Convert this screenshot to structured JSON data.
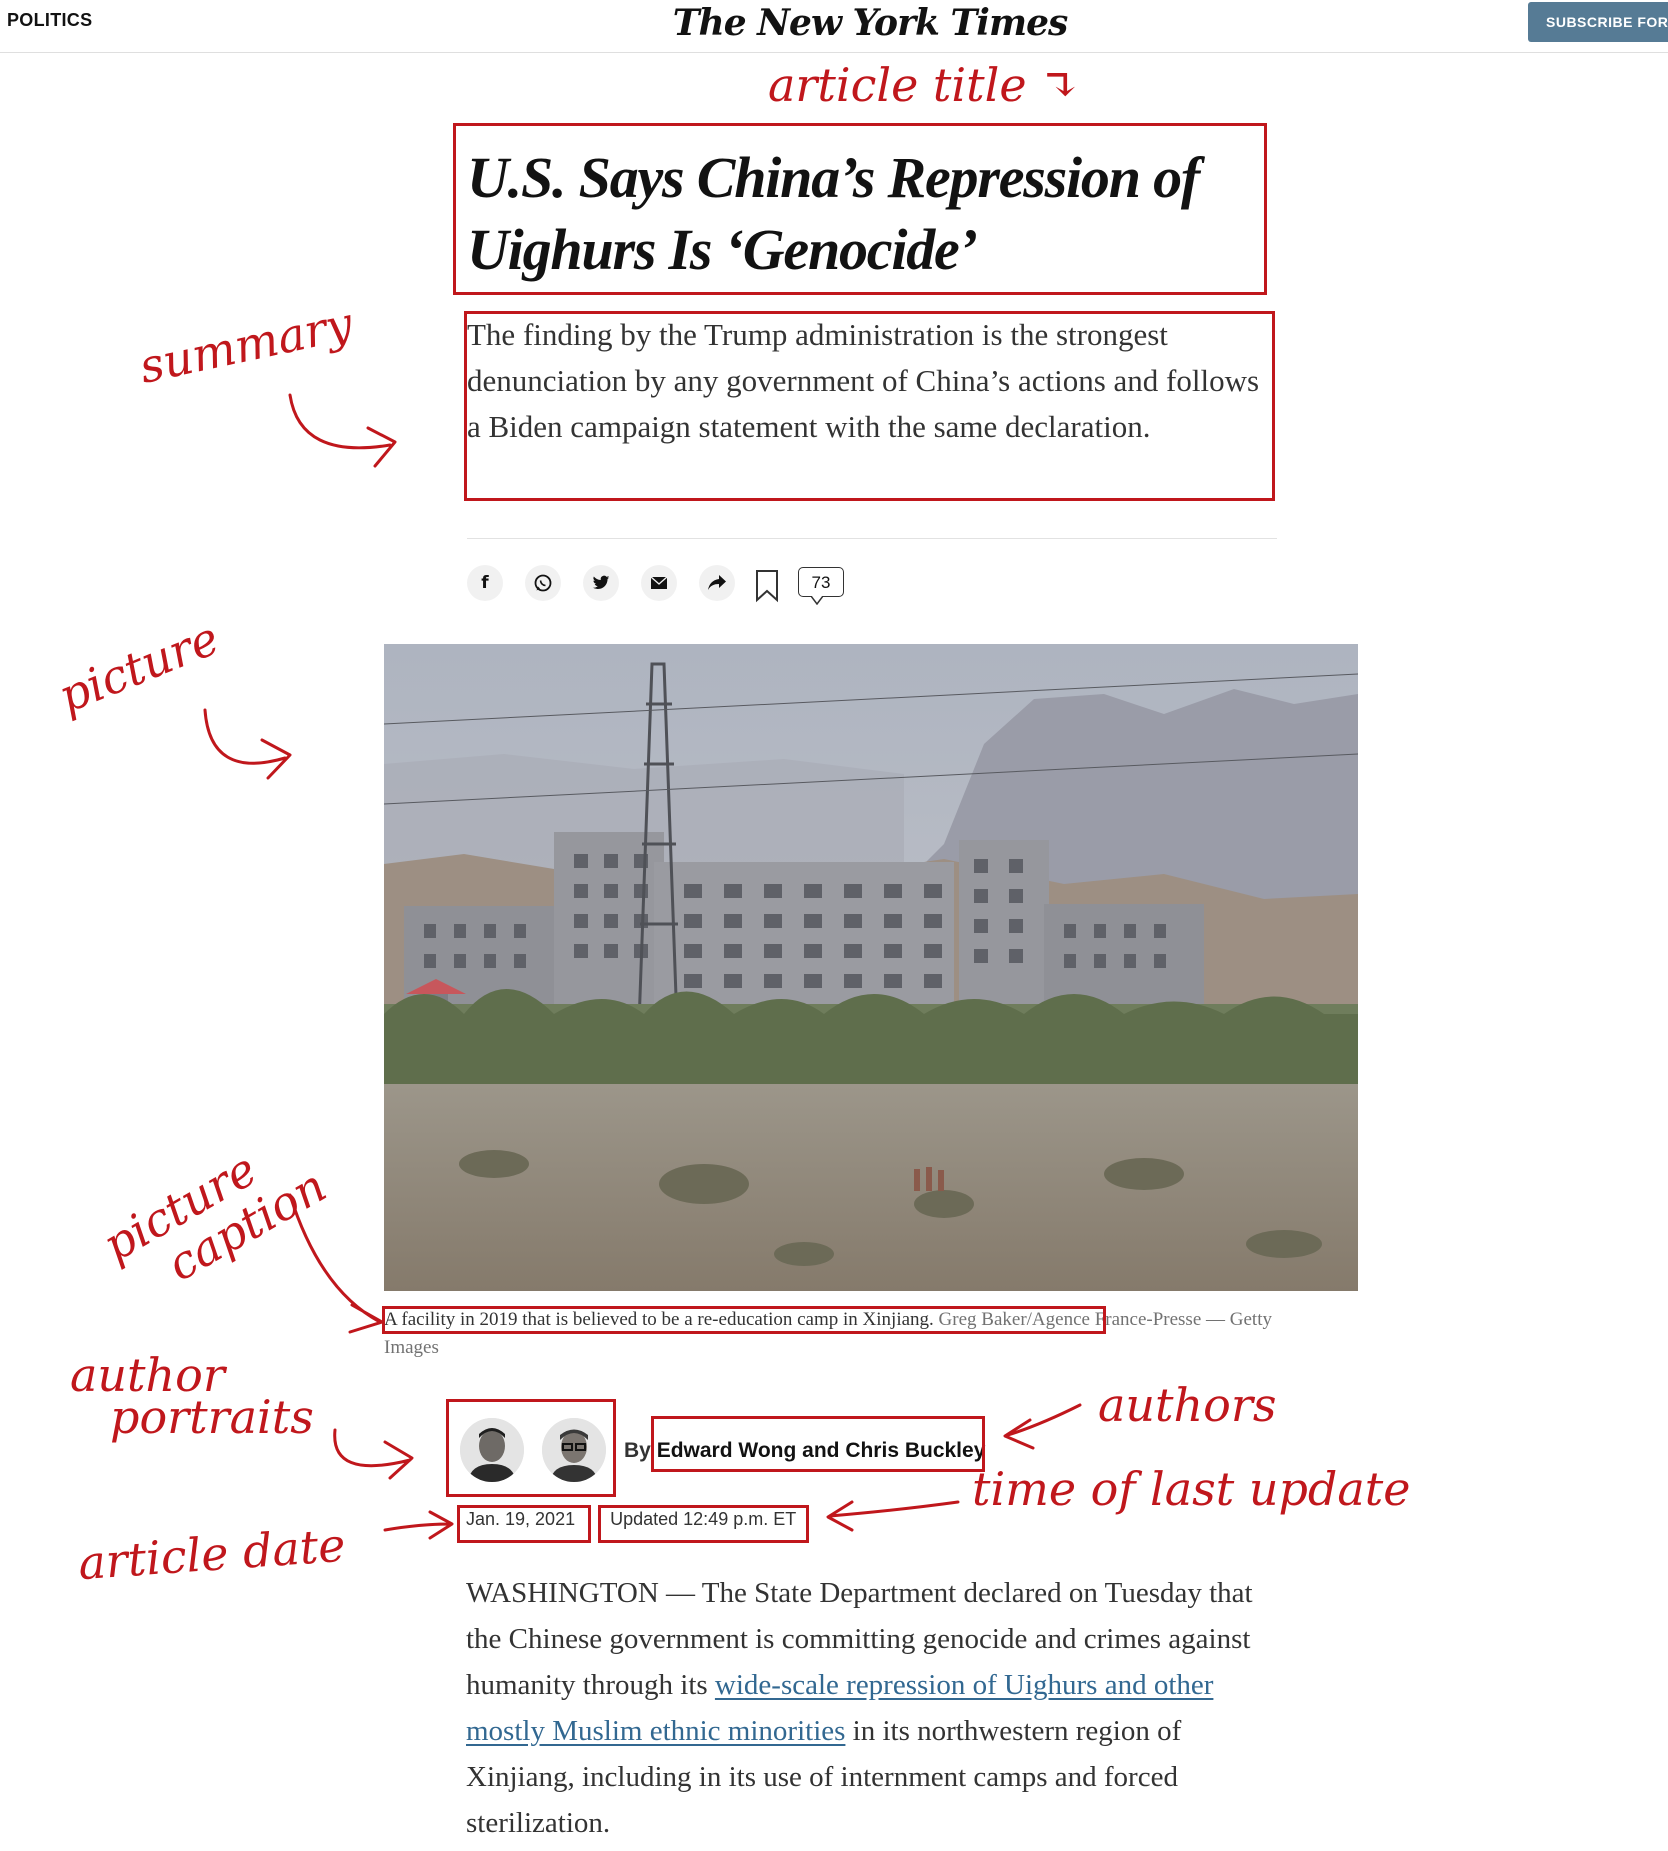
{
  "header": {
    "section": "POLITICS",
    "masthead": "The New York Times",
    "subscribe_label": "SUBSCRIBE FOR"
  },
  "article": {
    "headline": "U.S. Says China’s Repression of Uighurs Is ‘Genocide’",
    "summary": "The finding by the Trump administration is the strongest denunciation by any government of China’s actions and follows a Biden campaign statement with the same declaration.",
    "share": {
      "facebook": "f",
      "whatsapp_icon": "whatsapp-icon",
      "twitter_icon": "twitter-icon",
      "email_icon": "email-icon",
      "share_icon": "share-arrow-icon",
      "bookmark_icon": "bookmark-icon",
      "comment_count": "73"
    },
    "picture": {
      "caption": "A facility in 2019 that is believed to be a re-education camp in Xinjiang.",
      "credit": "Greg Baker/Agence France-Presse — Getty Images"
    },
    "byline": {
      "by": "By",
      "authors": "Edward Wong and Chris Buckley",
      "date": "Jan. 19, 2021",
      "updated": "Updated 12:49 p.m. ET"
    },
    "body": {
      "part1": "WASHINGTON — The State Department declared on Tuesday that the Chinese government is committing genocide and crimes against humanity through its ",
      "link": "wide-scale repression of Uighurs and other mostly Muslim ethnic minorities",
      "part2": " in its northwestern region of Xinjiang, including in its use of internment camps and forced sterilization."
    }
  },
  "annotations": {
    "article_title": "article title ↴",
    "summary": "summary",
    "picture": "picture",
    "picture_caption_1": "picture",
    "picture_caption_2": "caption",
    "author_portraits_1": "author",
    "author_portraits_2": "portraits",
    "authors": "authors",
    "time_of_last_update": "time of last update",
    "article_date": "article date"
  },
  "colors": {
    "annotation": "#c0171c",
    "link": "#326891",
    "subscribe_bg": "#567b95"
  }
}
